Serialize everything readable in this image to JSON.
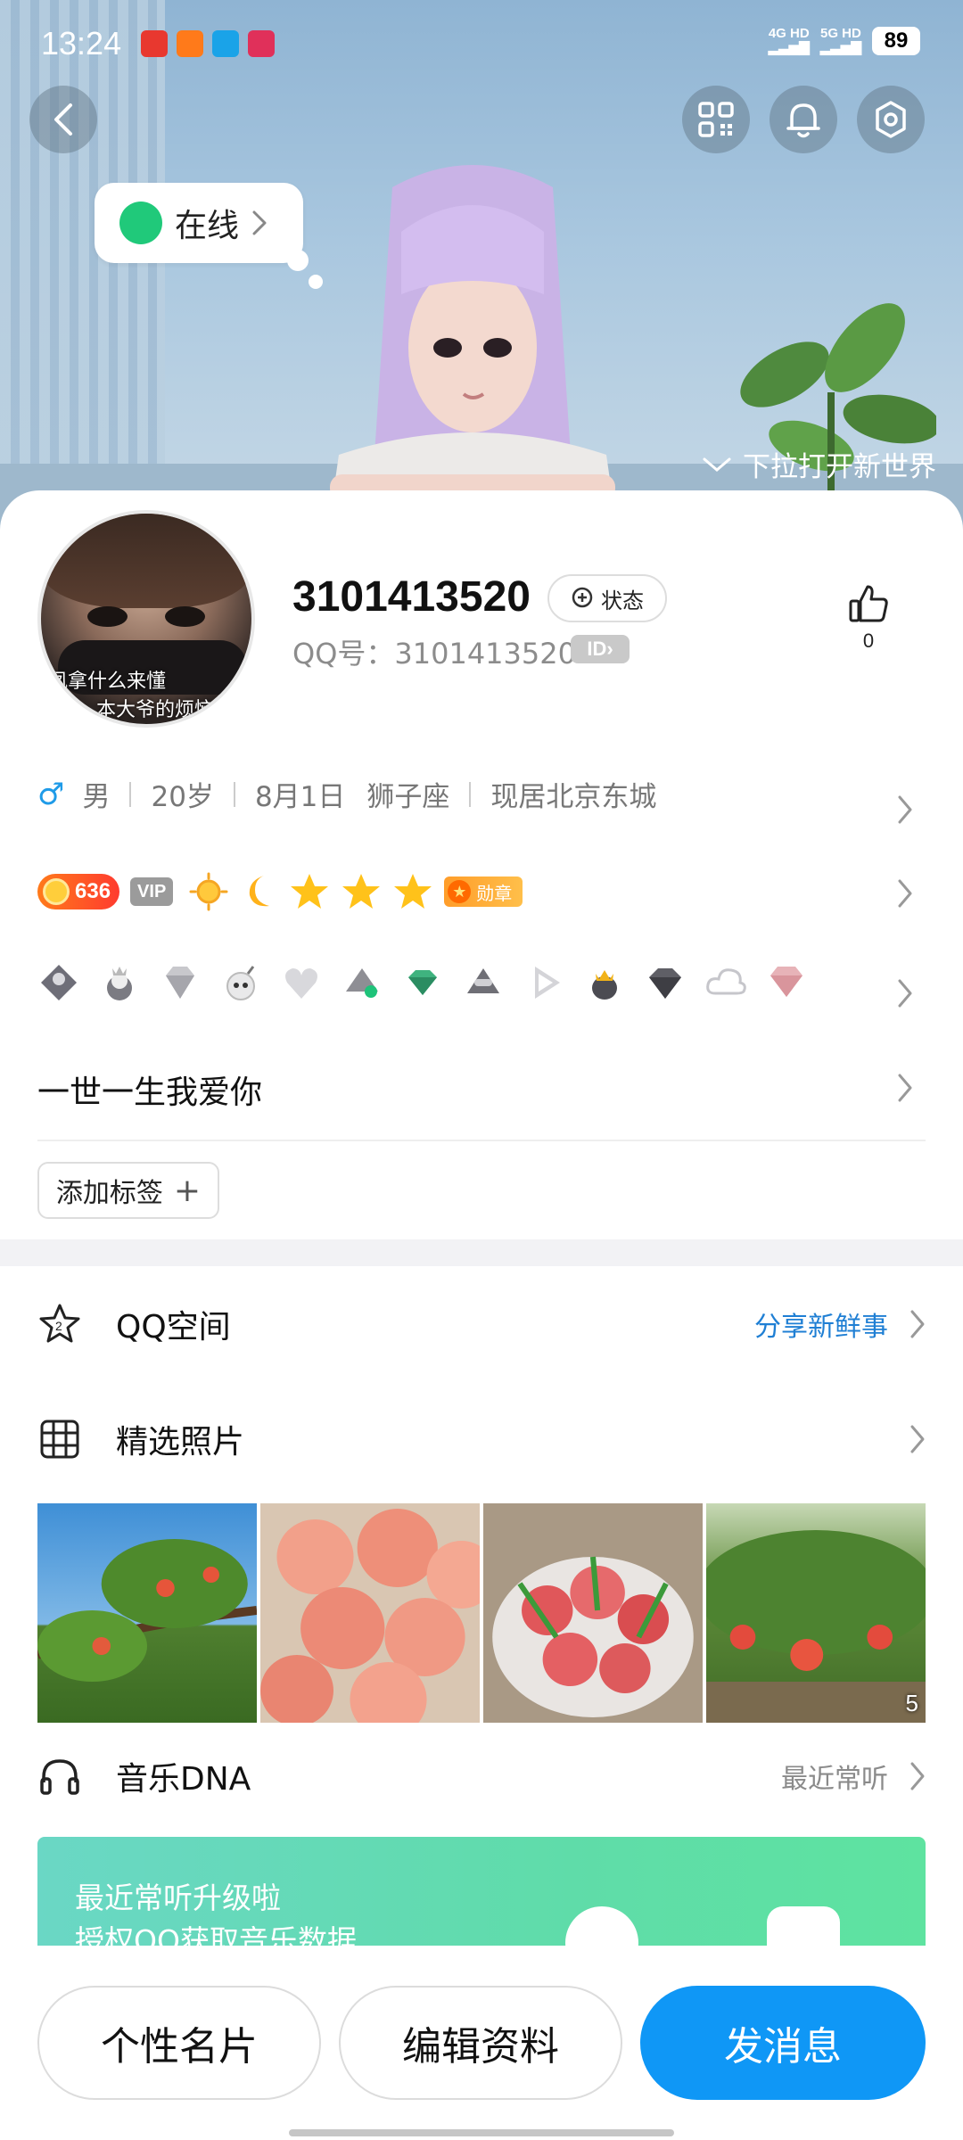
{
  "status_bar": {
    "time": "13:24",
    "network_1": "4G HD",
    "network_2": "5G HD",
    "battery": "89"
  },
  "hero": {
    "online_status": "在线",
    "pull_hint": "下拉打开新世界"
  },
  "profile": {
    "nickname": "3101413520",
    "state_label": "状态",
    "qq_number": "QQ号：3101413520",
    "id_badge": "ID",
    "like_count": "0",
    "avatar_caption_1": "凤拿什么来懂",
    "avatar_caption_2": "本大爷的烦恼",
    "gender_symbol": "♂",
    "gender": "男",
    "age": "20岁",
    "birthday": "8月1日",
    "zodiac": "狮子座",
    "location": "现居北京东城",
    "level": "636",
    "vip_label": "VIP",
    "medal_label": "勋章",
    "signature": "一世一生我爱你",
    "add_tag": "添加标签",
    "add_tag_plus": "+"
  },
  "sections": {
    "qzone": {
      "title": "QQ空间",
      "action": "分享新鲜事"
    },
    "photos": {
      "title": "精选照片",
      "count": "5"
    },
    "music": {
      "title": "音乐DNA",
      "action": "最近常听",
      "banner_line1": "最近常听升级啦",
      "banner_line2": "授权QQ获取音乐数据"
    }
  },
  "bottom_bar": {
    "card_button": "个性名片",
    "edit_button": "编辑资料",
    "message_button": "发消息"
  },
  "colors": {
    "accent_blue": "#0f97f6",
    "link_blue": "#1f7fd4",
    "online_green": "#20c97a"
  }
}
